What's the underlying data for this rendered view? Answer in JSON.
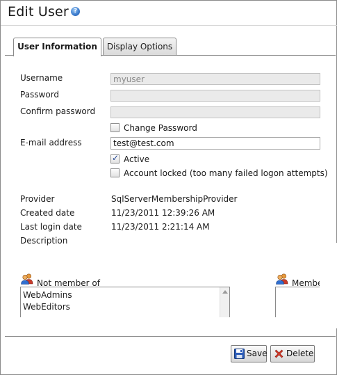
{
  "header": {
    "title": "Edit User",
    "help_icon": "question-mark-icon"
  },
  "tabs": [
    {
      "label": "User Information",
      "active": true
    },
    {
      "label": "Display Options",
      "active": false
    }
  ],
  "form": {
    "username_label": "Username",
    "username_value": "myuser",
    "password_label": "Password",
    "password_value": "",
    "confirm_password_label": "Confirm password",
    "confirm_password_value": "",
    "change_password_label": "Change Password",
    "change_password_checked": false,
    "email_label": "E-mail address",
    "email_value": "test@test.com",
    "active_label": "Active",
    "active_checked": true,
    "locked_label": "Account locked (too many failed logon attempts)",
    "locked_checked": false
  },
  "details": {
    "provider_label": "Provider",
    "provider_value": "SqlServerMembershipProvider",
    "created_label": "Created date",
    "created_value": "11/23/2011 12:39:26 AM",
    "last_login_label": "Last login date",
    "last_login_value": "11/23/2011 2:21:14 AM",
    "description_label": "Description"
  },
  "roles": {
    "not_member_label": "Not member of",
    "not_member_items": [
      "WebAdmins",
      "WebEditors"
    ],
    "member_label": "Member"
  },
  "footer": {
    "save_label": "Save",
    "delete_label": "Delete"
  },
  "colors": {
    "help_icon": "#3f7fd0",
    "delete_icon": "#d63a2a",
    "save_icon": "#2a5bb8"
  }
}
